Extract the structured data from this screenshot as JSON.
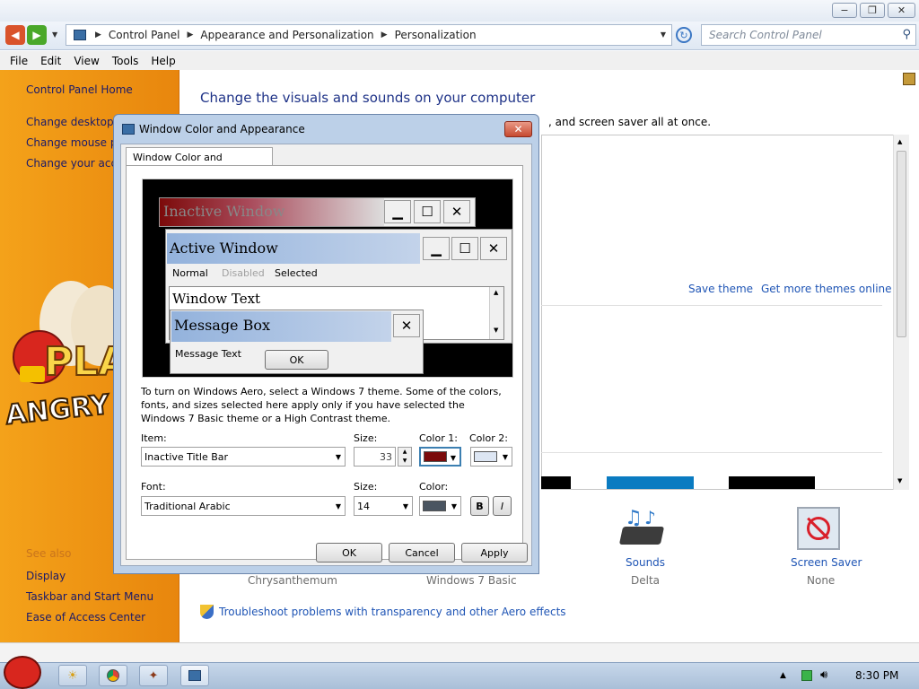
{
  "window": {
    "minimize": "−",
    "maximize": "❐",
    "close": "✕"
  },
  "address": {
    "crumbs": [
      "Control Panel",
      "Appearance and Personalization",
      "Personalization"
    ],
    "search_placeholder": "Search Control Panel"
  },
  "menu": [
    "File",
    "Edit",
    "View",
    "Tools",
    "Help"
  ],
  "sidebar": {
    "home": "Control Panel Home",
    "links": [
      "Change desktop ic",
      "Change mouse po",
      "Change your acco"
    ],
    "see_also": "See also",
    "bottom_links": [
      "Display",
      "Taskbar and Start Menu",
      "Ease of Access Center"
    ],
    "art_text_1": "PLA",
    "art_text_2": "ANGRY B"
  },
  "main": {
    "heading": "Change the visuals and sounds on your computer",
    "subtext": ", and screen saver all at once.",
    "save_theme": "Save theme",
    "get_more": "Get more themes online",
    "theme_names": [
      "Chrysanthemum",
      "Windows 7 Basic"
    ],
    "sounds": {
      "label": "Sounds",
      "value": "Delta"
    },
    "screen_saver": {
      "label": "Screen Saver",
      "value": "None"
    },
    "troubleshoot": "Troubleshoot problems with transparency and other Aero effects"
  },
  "dialog": {
    "title": "Window Color and Appearance",
    "tab": "Window Color and Appearance",
    "preview": {
      "inactive_title": "Inactive Window",
      "active_title": "Active Window",
      "menu_normal": "Normal",
      "menu_disabled": "Disabled",
      "menu_selected": "Selected",
      "window_text": "Window Text",
      "msgbox_title": "Message Box",
      "msgbox_text": "Message Text",
      "msgbox_ok": "OK"
    },
    "info": "To turn on Windows Aero, select a Windows 7 theme.  Some of the colors, fonts, and sizes selected here apply only if you have selected the Windows 7 Basic theme or a High Contrast theme.",
    "item_label": "Item:",
    "item_value": "Inactive Title Bar",
    "size_label": "Size:",
    "item_size": "33",
    "color1_label": "Color 1:",
    "color2_label": "Color 2:",
    "color1": "#7b0b0b",
    "color2": "#dde6f3",
    "font_label": "Font:",
    "font_value": "Traditional Arabic",
    "font_size_label": "Size:",
    "font_size": "14",
    "font_color_label": "Color:",
    "font_color": "#4a5561",
    "bold": "B",
    "italic": "I",
    "ok": "OK",
    "cancel": "Cancel",
    "apply": "Apply"
  },
  "taskbar": {
    "time": "8:30 PM"
  }
}
